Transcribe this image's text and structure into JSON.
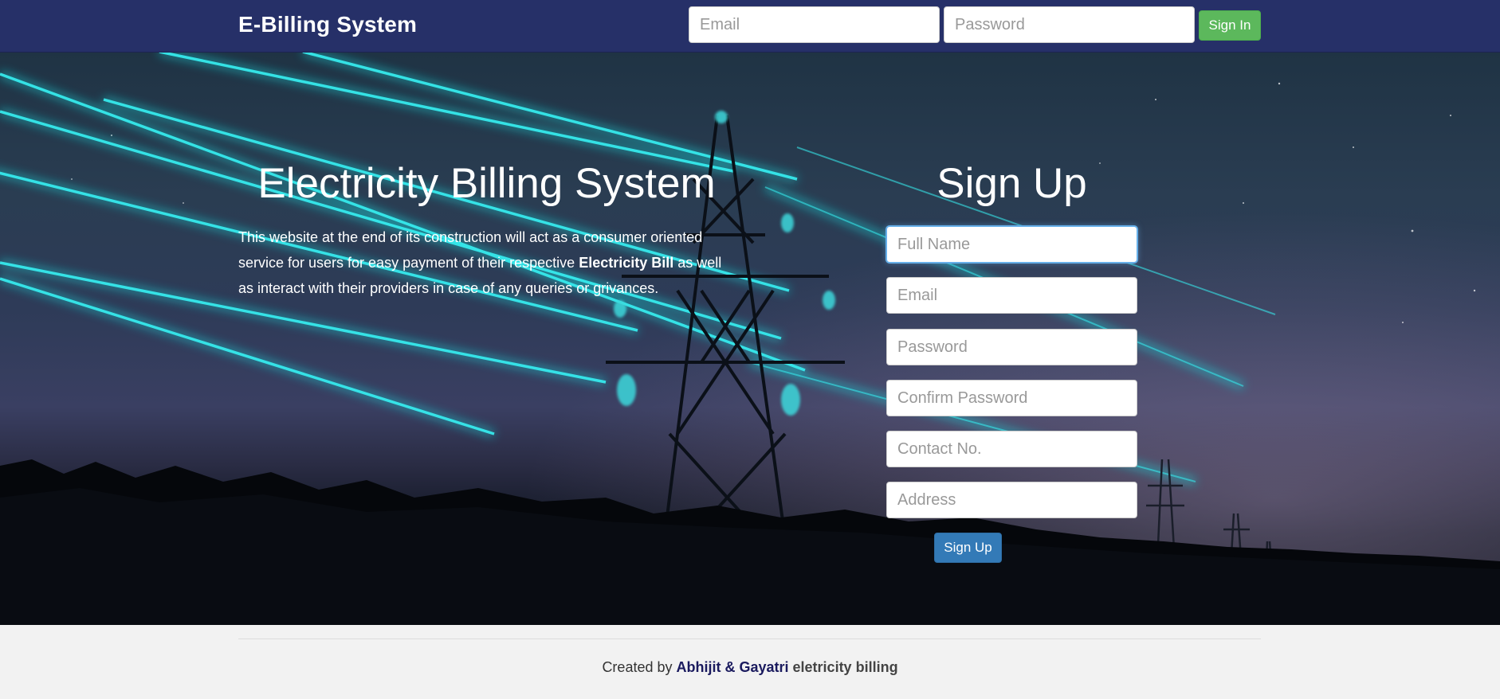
{
  "navbar": {
    "brand": "E-Billing System",
    "email_placeholder": "Email",
    "password_placeholder": "Password",
    "signin_label": "Sign In",
    "background_color": "#263068"
  },
  "hero": {
    "title": "Electricity Billing System",
    "description_part1": "This website at the end of its construction will act as a consumer oriented service for users for easy payment of their respective ",
    "description_bold": "Electricity Bill",
    "description_part2": " as well as interact with their providers in case of any queries or grivances.",
    "background": "night sky with glowing power lines and electricity pylon"
  },
  "signup": {
    "title": "Sign Up",
    "fields": [
      {
        "placeholder": "Full Name",
        "focused": true
      },
      {
        "placeholder": "Email"
      },
      {
        "placeholder": "Password"
      },
      {
        "placeholder": "Confirm Password"
      },
      {
        "placeholder": "Contact No."
      },
      {
        "placeholder": "Address"
      }
    ],
    "submit_label": "Sign Up",
    "submit_color": "#337ab7"
  },
  "footer": {
    "prefix": "Created by ",
    "authors": "Abhijit & Gayatri",
    "suffix": " eletricity billing"
  },
  "colors": {
    "signin_button": "#5cb85c",
    "glow": "#19d3d8"
  }
}
